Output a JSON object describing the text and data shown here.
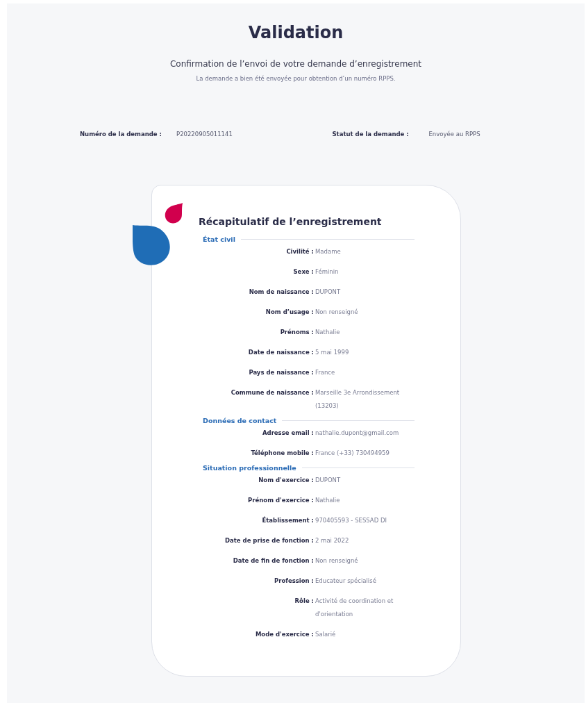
{
  "page": {
    "title": "Validation",
    "subtitle": "Confirmation de l’envoi de votre demande d’enregistrement",
    "description": "La demande a bien été envoyée pour obtention d’un numéro RPPS."
  },
  "request": [
    {
      "label": "Numéro de la demande :",
      "value": "P20220905011141"
    },
    {
      "label": "Statut de la demande :",
      "value": "Envoyée au RPPS"
    }
  ],
  "summary": {
    "title": "Récapitulatif de l’enregistrement",
    "sections": [
      {
        "title": "État civil",
        "fields": [
          {
            "label": "Civilité :",
            "value": "Madame"
          },
          {
            "label": "Sexe :",
            "value": "Féminin"
          },
          {
            "label": "Nom de naissance :",
            "value": "DUPONT"
          },
          {
            "label": "Nom d’usage :",
            "value": "Non renseigné"
          },
          {
            "label": "Prénoms :",
            "value": "Nathalie"
          },
          {
            "label": "Date de naissance :",
            "value": "5 mai 1999"
          },
          {
            "label": "Pays de naissance :",
            "value": "France"
          },
          {
            "label": "Commune de naissance :",
            "value": "Marseille 3e Arrondissement (13203)"
          }
        ]
      },
      {
        "title": "Données de contact",
        "fields": [
          {
            "label": "Adresse email :",
            "value": "nathalie.dupont@gmail.com"
          },
          {
            "label": "Téléphone mobile :",
            "value": "France (+33) 730494959"
          }
        ]
      },
      {
        "title": "Situation professionnelle",
        "fields": [
          {
            "label": "Nom d'exercice :",
            "value": "DUPONT"
          },
          {
            "label": "Prénom d'exercice :",
            "value": "Nathalie"
          },
          {
            "label": "Établissement :",
            "value": "970405593 - SESSAD DI"
          },
          {
            "label": "Date de prise de fonction :",
            "value": "2 mai 2022"
          },
          {
            "label": "Date de fin de fonction :",
            "value": "Non renseigné"
          },
          {
            "label": "Profession :",
            "value": "Educateur spécialisé"
          },
          {
            "label": "Rôle :",
            "value": "Activité de coordination et d'orientation"
          },
          {
            "label": "Mode d'exercice :",
            "value": "Salarié"
          }
        ]
      }
    ]
  }
}
